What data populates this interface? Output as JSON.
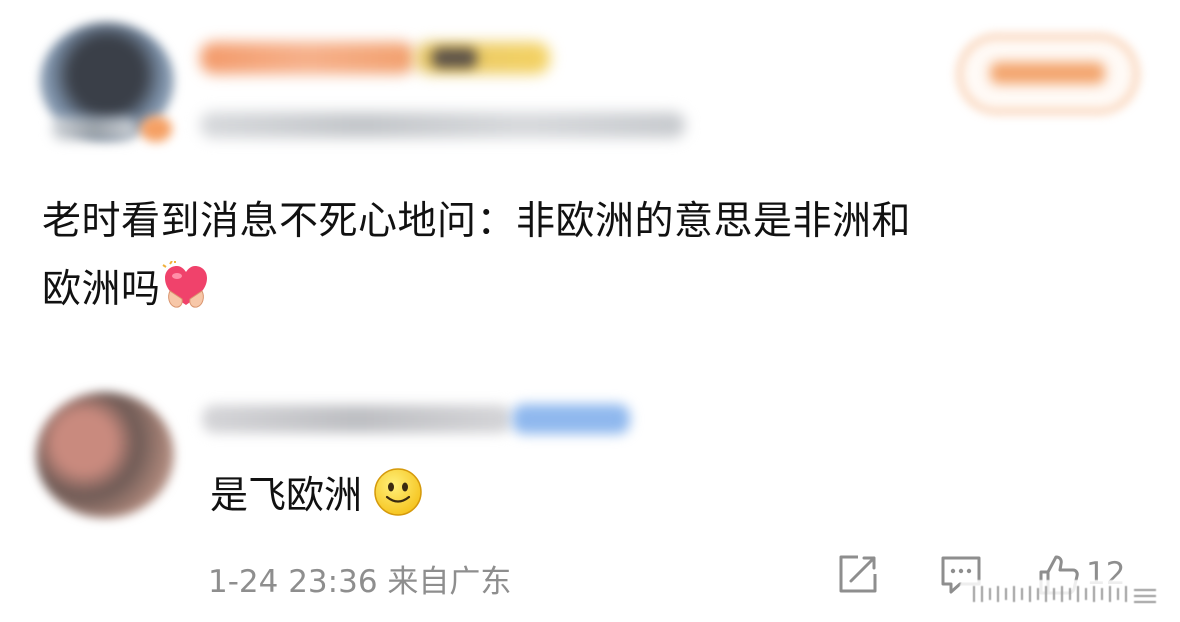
{
  "post": {
    "text_line1": "老时看到消息不死心地问：非欧洲的意思是非洲和",
    "text_line2": "欧洲吗",
    "emoji": "heart-hands-icon"
  },
  "comment": {
    "text": "是飞欧洲",
    "emoji": "smiley-icon",
    "time": "1-24 23:36",
    "location": "来自广东",
    "like_count": "12"
  },
  "colors": {
    "text": "#111111",
    "meta": "#8e8e8e",
    "accent_orange": "#f3a56e",
    "verified_blue": "#8fb8ee"
  }
}
